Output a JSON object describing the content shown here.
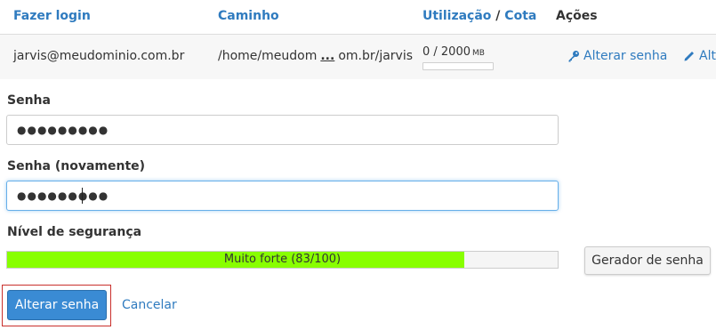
{
  "table": {
    "headers": {
      "login": "Fazer login",
      "path": "Caminho",
      "usage": "Utilização",
      "separator": "/",
      "quota": "Cota",
      "actions": "Ações"
    },
    "row": {
      "login": "jarvis@meudominio.com.br",
      "path_start": "/home/meudom",
      "path_ellipsis": "...",
      "path_end": "om.br/jarvis",
      "usage": "0 / 2000",
      "usage_unit": "MB",
      "usage_fraction": 0,
      "action_change_password": "Alterar senha",
      "action_edit": "Alt"
    }
  },
  "form": {
    "password_label": "Senha",
    "password_value": "●●●●●●●●●",
    "password_confirm_label": "Senha (novamente)",
    "password_confirm_value": "●●●●●●●●●",
    "strength_label": "Nível de segurança",
    "strength_text": "Muito forte (83/100)",
    "strength_percent": 83,
    "generator_button": "Gerador de senha",
    "submit_button": "Alterar senha",
    "cancel_link": "Cancelar"
  },
  "colors": {
    "link": "#2f7bbf",
    "strength_fill": "#88ff00",
    "primary_button": "#3a8bd4",
    "highlight_border": "#c9302c"
  },
  "icons": {
    "change_password": "key-icon",
    "edit": "pencil-icon"
  }
}
